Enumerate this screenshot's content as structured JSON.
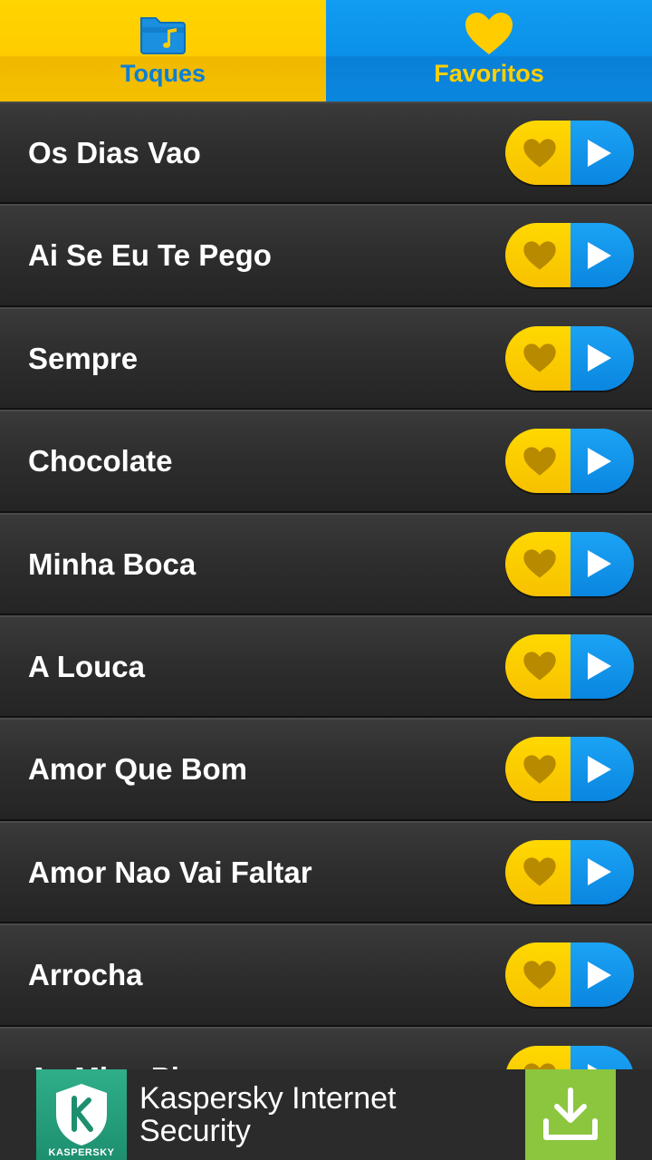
{
  "tabs": [
    {
      "label": "Toques",
      "icon": "folder-music-icon",
      "active": true
    },
    {
      "label": "Favoritos",
      "icon": "heart-icon",
      "active": false
    }
  ],
  "ringtones": [
    {
      "title": "Os Dias Vao"
    },
    {
      "title": "Ai Se Eu Te Pego"
    },
    {
      "title": "Sempre"
    },
    {
      "title": "Chocolate"
    },
    {
      "title": "Minha Boca"
    },
    {
      "title": "A Louca"
    },
    {
      "title": "Amor Que Bom"
    },
    {
      "title": "Amor Nao Vai Faltar"
    },
    {
      "title": "Arrocha"
    },
    {
      "title": "As Mina Pira"
    }
  ],
  "ad": {
    "title": "Kaspersky Internet Security",
    "logo_text": "KASPERSKY",
    "logo_icon": "kaspersky-shield-icon",
    "action_icon": "download-icon"
  },
  "colors": {
    "yellow": "#ffcc00",
    "blue": "#0a8ee6",
    "row_bg": "#2e2e2e",
    "ad_green": "#8cc63f"
  }
}
